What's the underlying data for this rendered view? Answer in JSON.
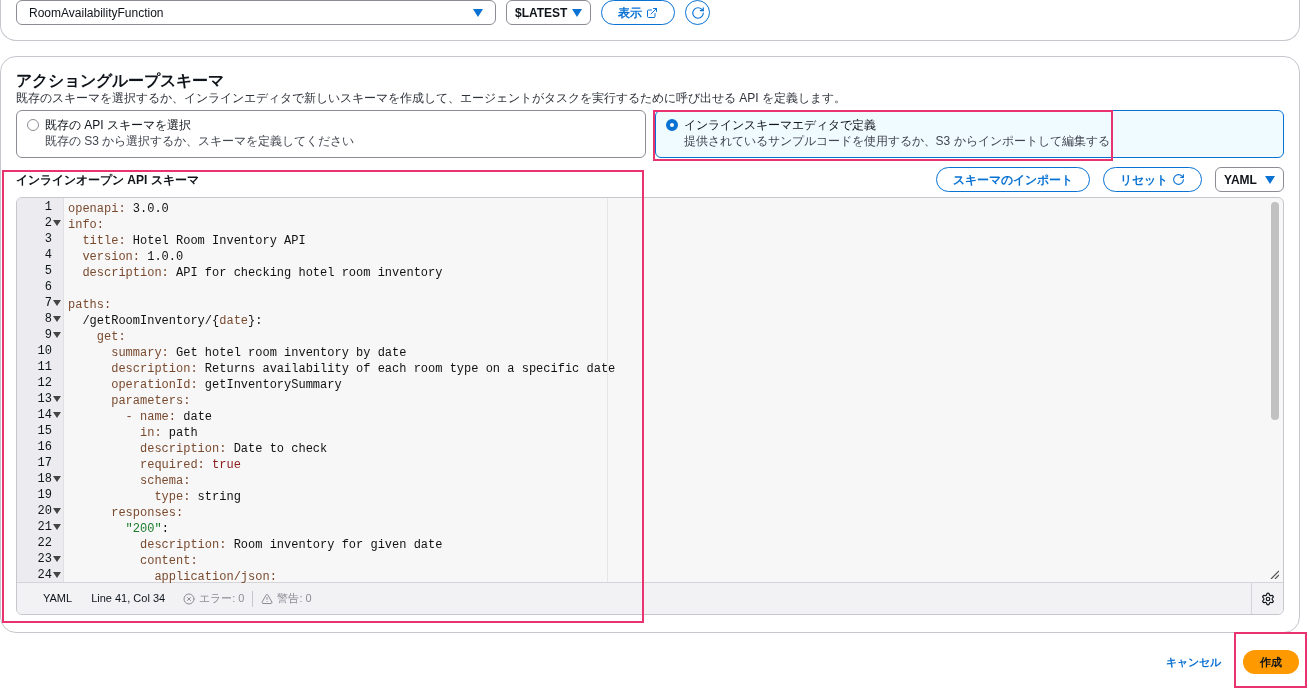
{
  "function_row": {
    "function_select": "RoomAvailabilityFunction",
    "version_select": "$LATEST",
    "view_button": "表示"
  },
  "schema_section": {
    "title": "アクショングループスキーマ",
    "description": "既存のスキーマを選択するか、インラインエディタで新しいスキーマを作成して、エージェントがタスクを実行するために呼び出せる API を定義します。",
    "options": [
      {
        "label": "既存の API スキーマを選択",
        "hint": "既存の S3 から選択するか、スキーマを定義してください",
        "selected": false
      },
      {
        "label": "インラインスキーマエディタで定義",
        "hint": "提供されているサンプルコードを使用するか、S3 からインポートして編集する",
        "selected": true
      }
    ],
    "editor_label": "インラインオープン API スキーマ",
    "import_button": "スキーマのインポート",
    "reset_button": "リセット",
    "format_select": "YAML",
    "code_lines": [
      {
        "number": "1",
        "foldable": false,
        "tokens": [
          {
            "text": "openapi:",
            "kind": "key"
          },
          {
            "text": " 3.0.0",
            "kind": "plain"
          }
        ]
      },
      {
        "number": "2",
        "foldable": true,
        "tokens": [
          {
            "text": "info:",
            "kind": "key"
          }
        ]
      },
      {
        "number": "3",
        "foldable": false,
        "tokens": [
          {
            "text": "  title:",
            "kind": "key"
          },
          {
            "text": " Hotel Room Inventory API",
            "kind": "plain"
          }
        ]
      },
      {
        "number": "4",
        "foldable": false,
        "tokens": [
          {
            "text": "  version:",
            "kind": "key"
          },
          {
            "text": " 1.0.0",
            "kind": "plain"
          }
        ]
      },
      {
        "number": "5",
        "foldable": false,
        "tokens": [
          {
            "text": "  description:",
            "kind": "key"
          },
          {
            "text": " API for checking hotel room inventory",
            "kind": "plain"
          }
        ]
      },
      {
        "number": "6",
        "foldable": false
      },
      {
        "number": "7",
        "foldable": true,
        "tokens": [
          {
            "text": "paths:",
            "kind": "key"
          }
        ]
      },
      {
        "number": "8",
        "foldable": true,
        "tokens": [
          {
            "text": "  /getRoomInventory/{",
            "kind": "plain"
          },
          {
            "text": "date",
            "kind": "key"
          },
          {
            "text": "}:",
            "kind": "plain"
          }
        ]
      },
      {
        "number": "9",
        "foldable": true,
        "tokens": [
          {
            "text": "    get:",
            "kind": "key"
          }
        ]
      },
      {
        "number": "10",
        "foldable": false,
        "tokens": [
          {
            "text": "      summary:",
            "kind": "key"
          },
          {
            "text": " Get hotel room inventory by date",
            "kind": "plain"
          }
        ]
      },
      {
        "number": "11",
        "foldable": false,
        "tokens": [
          {
            "text": "      description:",
            "kind": "key"
          },
          {
            "text": " Returns availability of each room type on a specific date",
            "kind": "plain"
          }
        ]
      },
      {
        "number": "12",
        "foldable": false,
        "tokens": [
          {
            "text": "      operationId:",
            "kind": "key"
          },
          {
            "text": " getInventorySummary",
            "kind": "plain"
          }
        ]
      },
      {
        "number": "13",
        "foldable": true,
        "tokens": [
          {
            "text": "      parameters:",
            "kind": "key"
          }
        ]
      },
      {
        "number": "14",
        "foldable": true,
        "tokens": [
          {
            "text": "        - name:",
            "kind": "key"
          },
          {
            "text": " date",
            "kind": "plain"
          }
        ]
      },
      {
        "number": "15",
        "foldable": false,
        "tokens": [
          {
            "text": "          in:",
            "kind": "key"
          },
          {
            "text": " path",
            "kind": "plain"
          }
        ]
      },
      {
        "number": "16",
        "foldable": false,
        "tokens": [
          {
            "text": "          description:",
            "kind": "key"
          },
          {
            "text": " Date to check",
            "kind": "plain"
          }
        ]
      },
      {
        "number": "17",
        "foldable": false,
        "tokens": [
          {
            "text": "          required:",
            "kind": "key"
          },
          {
            "text": " true",
            "kind": "bool"
          }
        ]
      },
      {
        "number": "18",
        "foldable": true,
        "tokens": [
          {
            "text": "          schema:",
            "kind": "key"
          }
        ]
      },
      {
        "number": "19",
        "foldable": false,
        "tokens": [
          {
            "text": "            type:",
            "kind": "key"
          },
          {
            "text": " string",
            "kind": "plain"
          }
        ]
      },
      {
        "number": "20",
        "foldable": true,
        "tokens": [
          {
            "text": "      responses:",
            "kind": "key"
          }
        ]
      },
      {
        "number": "21",
        "foldable": true,
        "tokens": [
          {
            "text": "        \"200\"",
            "kind": "string"
          },
          {
            "text": ":",
            "kind": "plain"
          }
        ]
      },
      {
        "number": "22",
        "foldable": false,
        "tokens": [
          {
            "text": "          description:",
            "kind": "key"
          },
          {
            "text": " Room inventory for given date",
            "kind": "plain"
          }
        ]
      },
      {
        "number": "23",
        "foldable": true,
        "tokens": [
          {
            "text": "          content:",
            "kind": "key"
          }
        ]
      },
      {
        "number": "24",
        "foldable": true,
        "tokens": [
          {
            "text": "            application/json:",
            "kind": "key"
          }
        ]
      }
    ],
    "status_bar": {
      "language": "YAML",
      "cursor": "Line 41, Col 34",
      "errors": "エラー: 0",
      "warnings": "警告: 0"
    }
  },
  "footer": {
    "cancel_button": "キャンセル",
    "create_button": "作成"
  }
}
